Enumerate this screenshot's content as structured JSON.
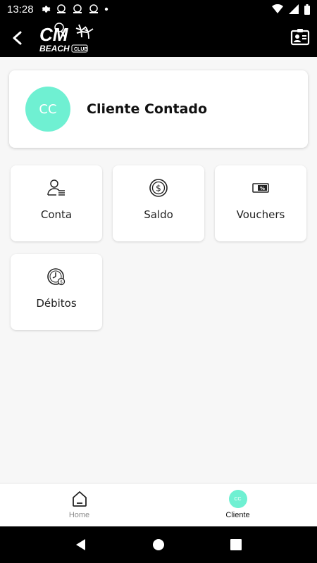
{
  "status_bar": {
    "time": "13:28"
  },
  "app_bar": {
    "logo_text_top": "CM",
    "logo_text_bottom": "BEACH",
    "logo_text_club": "CLUB"
  },
  "profile": {
    "initials": "CC",
    "name": "Cliente Contado",
    "avatar_color": "#6ff0d2"
  },
  "tiles": [
    {
      "label": "Conta",
      "icon": "user-list-icon"
    },
    {
      "label": "Saldo",
      "icon": "dollar-coin-icon"
    },
    {
      "label": "Vouchers",
      "icon": "voucher-percent-icon"
    },
    {
      "label": "Débitos",
      "icon": "clock-debit-icon"
    }
  ],
  "bottom_nav": {
    "home_label": "Home",
    "cliente_label": "Cliente",
    "cliente_initials": "CC"
  }
}
